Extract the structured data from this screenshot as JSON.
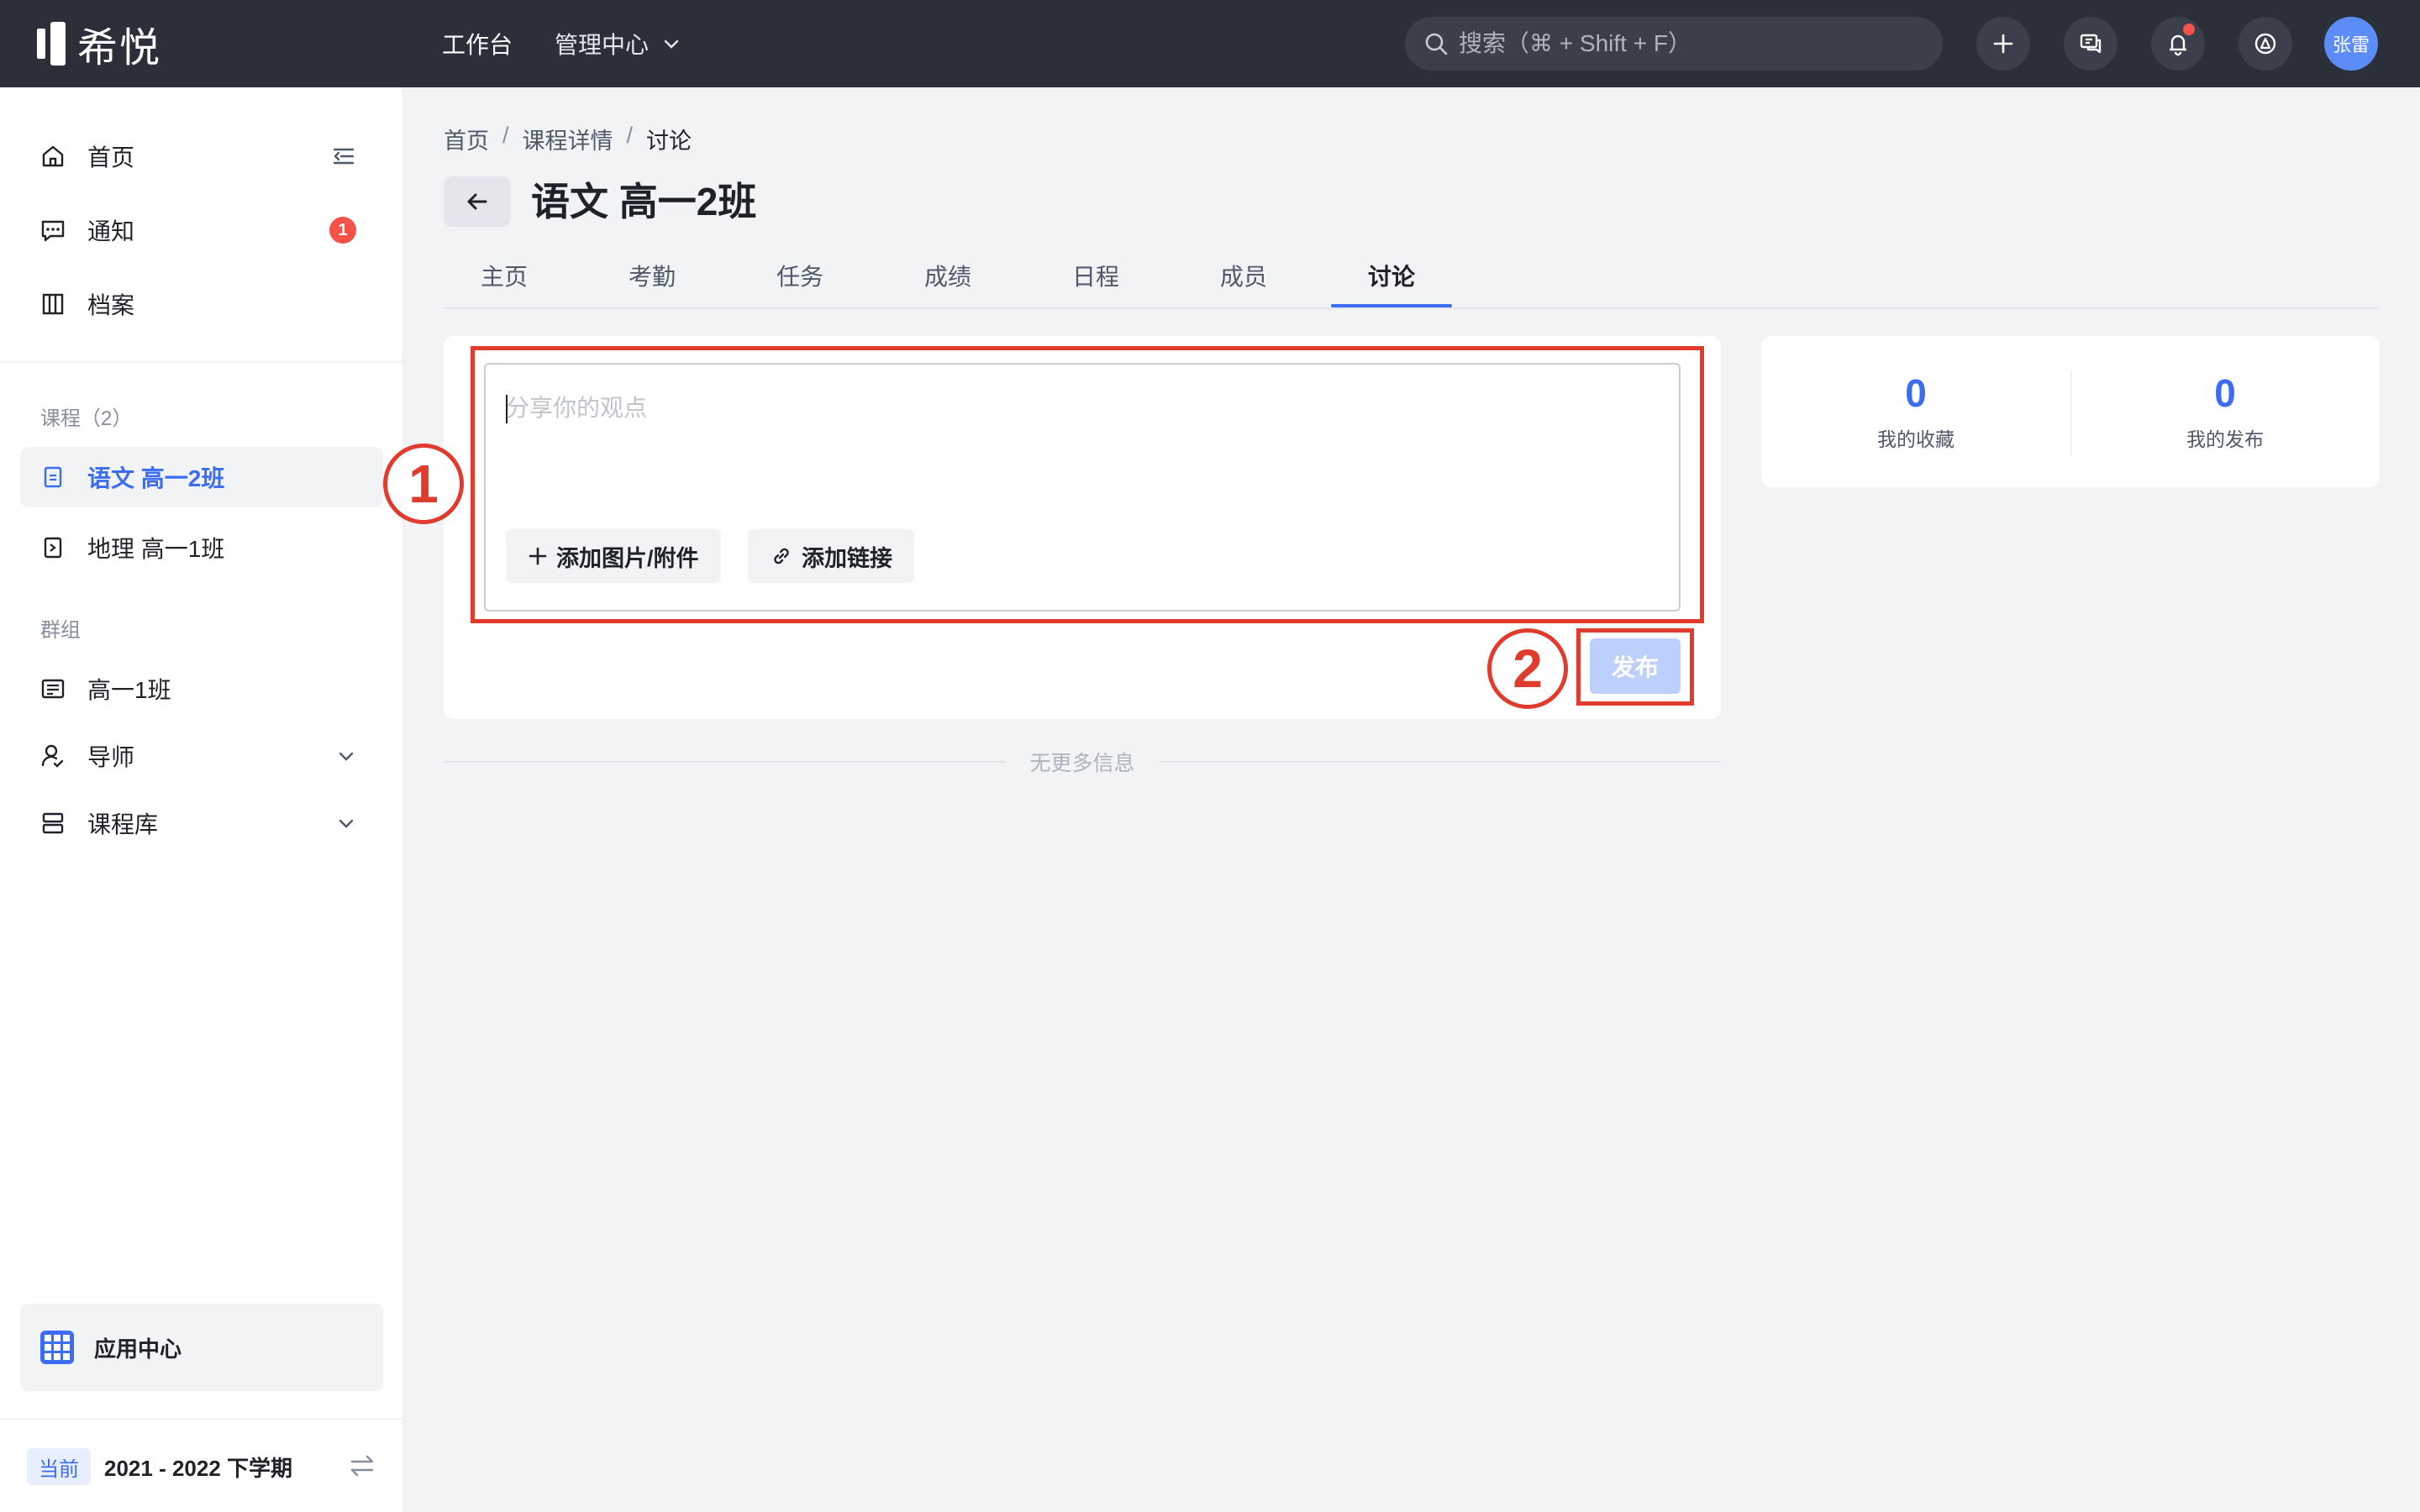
{
  "app": {
    "logo_text": "希悦"
  },
  "topnav": {
    "workbench": "工作台",
    "admin_center": "管理中心"
  },
  "search": {
    "placeholder": "搜索（⌘ + Shift + F）"
  },
  "user": {
    "avatar_text": "张雷"
  },
  "sidebar": {
    "home": "首页",
    "notice": "通知",
    "notice_count": "1",
    "archive": "档案",
    "courses_section": "课程（2）",
    "courses": [
      "语文 高一2班",
      "地理 高一1班"
    ],
    "groups_section": "群组",
    "group_class": "高一1班",
    "mentor": "导师",
    "course_library": "课程库",
    "app_center": "应用中心",
    "term_tag": "当前",
    "term": "2021 - 2022 下学期"
  },
  "breadcrumb": [
    "首页",
    "课程详情",
    "讨论"
  ],
  "page": {
    "title": "语文 高一2班"
  },
  "tabs": [
    "主页",
    "考勤",
    "任务",
    "成绩",
    "日程",
    "成员",
    "讨论"
  ],
  "active_tab": "讨论",
  "post": {
    "placeholder": "分享你的观点",
    "add_attachment": "添加图片/附件",
    "add_link": "添加链接",
    "publish": "发布"
  },
  "annotations": {
    "marker1": "1",
    "marker2": "2"
  },
  "feed": {
    "no_more": "无更多信息"
  },
  "stats": {
    "favorites_count": "0",
    "favorites_label": "我的收藏",
    "published_count": "0",
    "published_label": "我的发布"
  },
  "colors": {
    "accent": "#3b6cf2",
    "highlight": "#e03c2e",
    "topbar": "#2b2f3a"
  }
}
